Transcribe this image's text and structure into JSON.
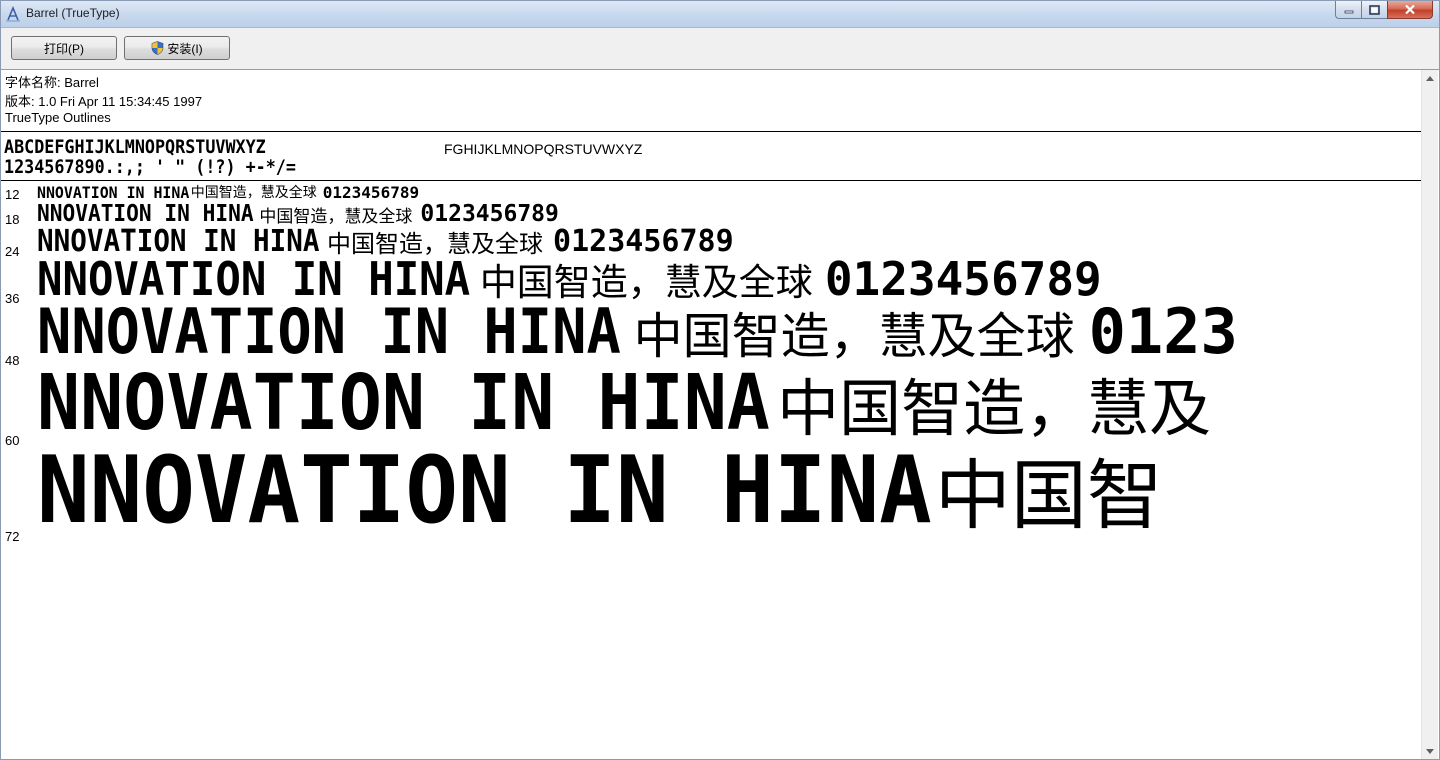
{
  "window": {
    "title": "Barrel (TrueType)",
    "icon": "font-viewer-icon",
    "controls": [
      "minimize-icon",
      "maximize-icon",
      "close-icon"
    ]
  },
  "toolbar": {
    "print_label": "打印(P)",
    "install_label": "安装(I)",
    "install_icon": "shield-icon"
  },
  "font_info": {
    "name_line": "字体名称: Barrel",
    "version_line": "版本: 1.0 Fri Apr 11 15:34:45 1997",
    "outline_line": "TrueType Outlines"
  },
  "charset": {
    "uppercase": "ABCDEFGHIJKLMNOPQRSTUVWXYZ",
    "digits_symbols": "1234567890.:,; ' \" (!?) +-*/=",
    "plain_fallback": "FGHIJKLMNOPQRSTUVWXYZ"
  },
  "samples": [
    {
      "size": "12",
      "latin": "NNOVATION IN  HINA",
      "cjk": "中国智造，慧及全球",
      "digits": "0123456789"
    },
    {
      "size": "18",
      "latin": "NNOVATION IN  HINA",
      "cjk": "中国智造，慧及全球",
      "digits": "0123456789"
    },
    {
      "size": "24",
      "latin": "NNOVATION IN  HINA",
      "cjk": "中国智造，慧及全球",
      "digits": "0123456789"
    },
    {
      "size": "36",
      "latin": "NNOVATION IN  HINA",
      "cjk": "中国智造，慧及全球",
      "digits": "0123456789"
    },
    {
      "size": "48",
      "latin": "NNOVATION IN  HINA",
      "cjk": "中国智造，慧及全球",
      "digits": "0123"
    },
    {
      "size": "60",
      "latin": "NNOVATION IN  HINA",
      "cjk": "中国智造，慧及",
      "digits": ""
    },
    {
      "size": "72",
      "latin": "NNOVATION IN  HINA",
      "cjk": "中国智",
      "digits": ""
    }
  ],
  "scrollbar": {
    "up_icon": "scroll-up-arrow-icon",
    "down_icon": "scroll-down-arrow-icon"
  }
}
